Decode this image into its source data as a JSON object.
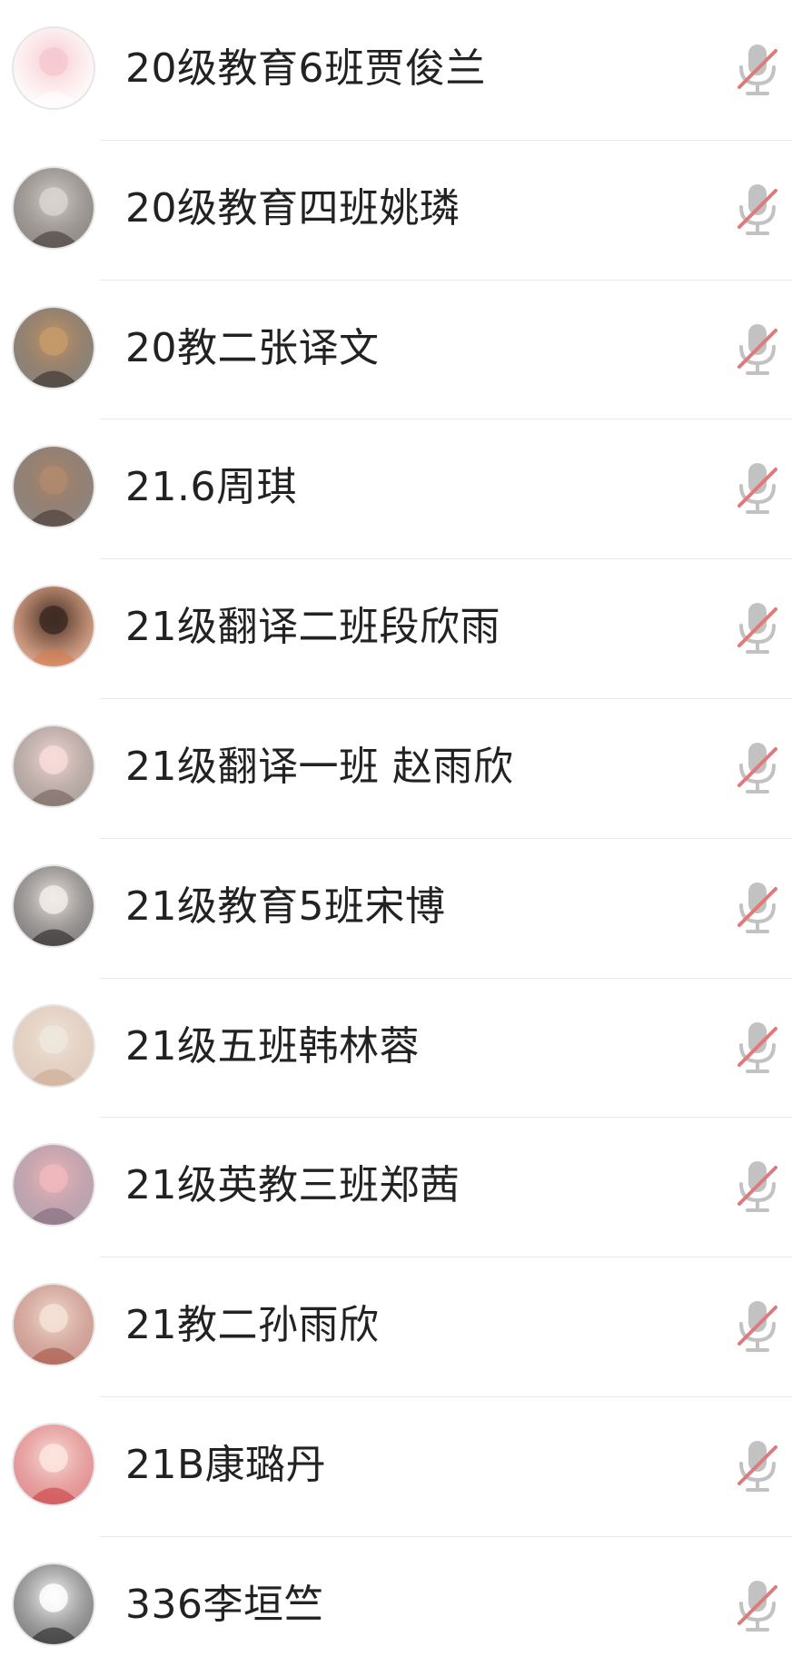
{
  "participants": [
    {
      "name": "20级教育6班贾俊兰",
      "avatar_icon": "cartoon-pink-face-avatar",
      "mic_icon": "microphone-muted-icon",
      "avatar_colors": [
        "#f6c9cf",
        "#ffffff"
      ]
    },
    {
      "name": "20级教育四班姚璘",
      "avatar_icon": "child-photo-avatar",
      "mic_icon": "microphone-muted-icon",
      "avatar_colors": [
        "#d9d4cf",
        "#3a302a"
      ]
    },
    {
      "name": "20教二张译文",
      "avatar_icon": "person-photo-avatar",
      "mic_icon": "microphone-muted-icon",
      "avatar_colors": [
        "#c79a6a",
        "#2b2420"
      ]
    },
    {
      "name": "21.6周琪",
      "avatar_icon": "street-photo-avatar",
      "mic_icon": "microphone-muted-icon",
      "avatar_colors": [
        "#b08a6e",
        "#3a2e28"
      ]
    },
    {
      "name": "21级翻译二班段欣雨",
      "avatar_icon": "night-scene-avatar",
      "mic_icon": "microphone-muted-icon",
      "avatar_colors": [
        "#3d2a22",
        "#d97a4a"
      ]
    },
    {
      "name": "21级翻译一班 赵雨欣",
      "avatar_icon": "cartoon-bored-face-avatar",
      "mic_icon": "microphone-muted-icon",
      "avatar_colors": [
        "#f7dcd9",
        "#6b5a52"
      ]
    },
    {
      "name": "21级教育5班宋博",
      "avatar_icon": "girl-portrait-avatar",
      "mic_icon": "microphone-muted-icon",
      "avatar_colors": [
        "#f2ece8",
        "#1e1a1a"
      ]
    },
    {
      "name": "21级五班韩林蓉",
      "avatar_icon": "pale-cartoon-avatar",
      "mic_icon": "microphone-muted-icon",
      "avatar_colors": [
        "#efe7dd",
        "#caa58c"
      ]
    },
    {
      "name": "21级英教三班郑茜",
      "avatar_icon": "pink-sky-avatar",
      "mic_icon": "microphone-muted-icon",
      "avatar_colors": [
        "#f0b9bd",
        "#7a5f74"
      ]
    },
    {
      "name": "21教二孙雨欣",
      "avatar_icon": "illustrated-girl-avatar",
      "mic_icon": "microphone-muted-icon",
      "avatar_colors": [
        "#f4e2d6",
        "#a34a3a"
      ]
    },
    {
      "name": "21B康璐丹",
      "avatar_icon": "cartoon-red-bow-avatar",
      "mic_icon": "microphone-muted-icon",
      "avatar_colors": [
        "#fbe5de",
        "#c8373a"
      ]
    },
    {
      "name": "336李垣竺",
      "avatar_icon": "line-art-girl-avatar",
      "mic_icon": "microphone-muted-icon",
      "avatar_colors": [
        "#ffffff",
        "#1a1a1a"
      ]
    }
  ],
  "colors": {
    "divider": "#e9e9e9",
    "name_text": "#222222",
    "mic_body": "#c2c2c2",
    "mute_slash": "#e07a7a"
  }
}
